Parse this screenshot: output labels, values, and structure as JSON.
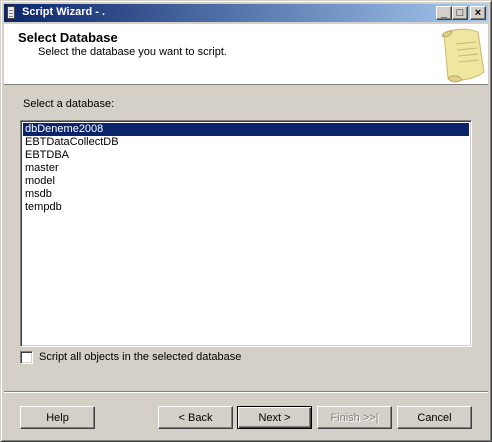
{
  "window": {
    "title": "Script Wizard - .",
    "minimize_glyph": "_",
    "maximize_glyph": "□",
    "close_glyph": "×"
  },
  "header": {
    "title": "Select Database",
    "subtitle": "Select the database you want to script."
  },
  "database_list": {
    "label": "Select a database:",
    "items": [
      "dbDeneme2008",
      "EBTDataCollectDB",
      "EBTDBA",
      "master",
      "model",
      "msdb",
      "tempdb"
    ],
    "selected": "dbDeneme2008"
  },
  "script_all": {
    "label": "Script all objects in the selected database",
    "checked": false
  },
  "buttons": {
    "help": "Help",
    "back": "< Back",
    "next": "Next >",
    "finish": "Finish >>|",
    "cancel": "Cancel"
  }
}
